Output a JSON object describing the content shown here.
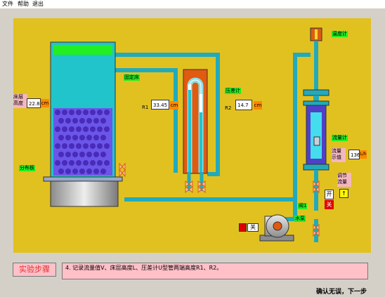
{
  "menu": {
    "file": "文件",
    "help": "帮助",
    "exit": "退出"
  },
  "labels": {
    "fixed_bed": "固定床",
    "distributor": "分布板",
    "bed_height": "床层\n高度",
    "pressure_gauge": "压差计",
    "thermometer": "温度计",
    "flowmeter": "流量计",
    "flow_display": "流量\n示值",
    "adjust_flow": "调节\n流量",
    "valve1": "阀1",
    "pump": "水泵"
  },
  "readings": {
    "bed_height_value": "22.8",
    "bed_height_unit": "cm",
    "r1_label": "R1",
    "r1_value": "33.45",
    "r1_unit": "cm",
    "r2_label": "R2",
    "r2_value": "14.7",
    "r2_unit": "cm",
    "flow_value": "136",
    "flow_unit": "L/h"
  },
  "controls": {
    "open": "开",
    "close_red": "关",
    "pump_close": "关"
  },
  "steps": {
    "title": "实验步骤",
    "text": "4. 记录流量值V、床层高度L、压差计U型管两端高度R1、R2。",
    "next": "确认无误，下一步"
  }
}
